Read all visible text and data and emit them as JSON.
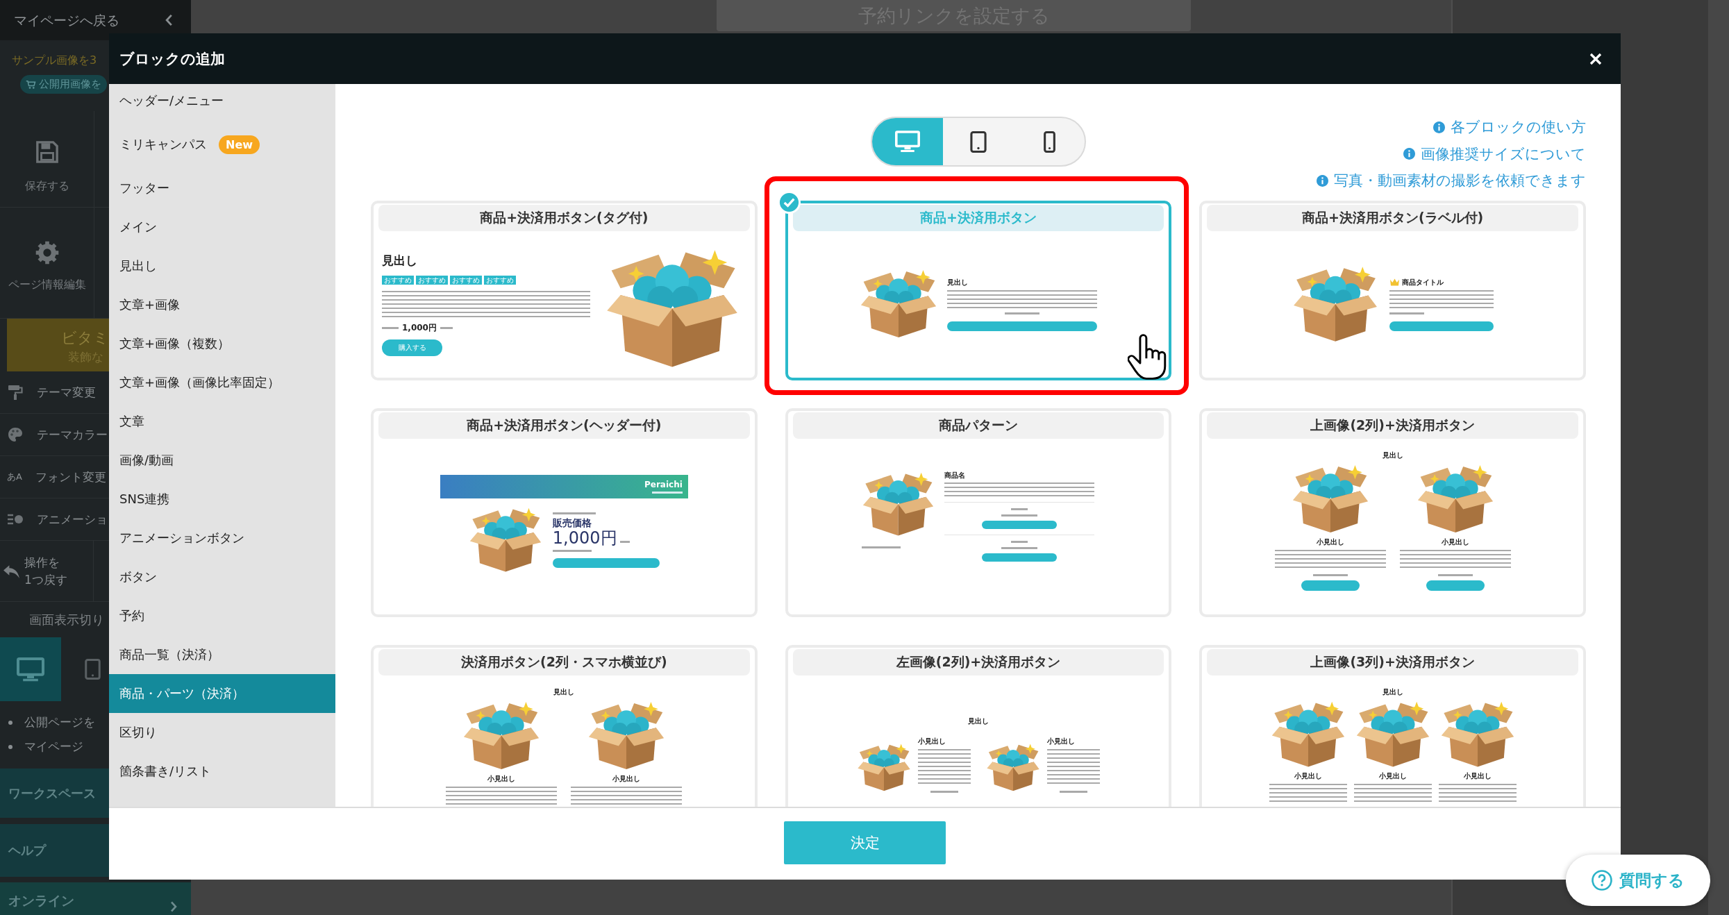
{
  "background": {
    "sidebar": {
      "back_link": "マイページへ戻る",
      "notice": "サンプル画像を3",
      "notice_button": "公開用画像を",
      "actions": [
        {
          "kind": "save",
          "label": "保存する"
        },
        {
          "kind": "settings",
          "label": "ページ情報編集"
        }
      ],
      "banner": {
        "title": "ビタミ",
        "subtitle": "装飾な"
      },
      "menu": [
        {
          "kind": "roller",
          "label": "テーマ変更"
        },
        {
          "kind": "palette",
          "label": "テーマカラー"
        },
        {
          "kind": "font",
          "glyph": "あA",
          "label": "フォント変更"
        },
        {
          "kind": "animation",
          "label": "アニメーショ"
        }
      ],
      "undo": "操作を\n1つ戻す",
      "view_switch": {
        "label": "画面表示切り",
        "devices": [
          {
            "kind": "desktop",
            "selected": true
          },
          {
            "kind": "tablet",
            "selected": false
          }
        ]
      },
      "links": [
        "公開ページを",
        "マイページ"
      ],
      "sections": [
        "ワークスペース",
        "ヘルプ"
      ],
      "footer_section": "オンライン"
    },
    "top_button": "予約リンクを設定する"
  },
  "modal": {
    "title": "ブロックの追加",
    "categories": [
      {
        "label": "ヘッダー/メニュー",
        "selected": false
      },
      {
        "label": "ミリキャンパス",
        "badge": "New",
        "selected": false
      },
      {
        "label": "フッター",
        "selected": false
      },
      {
        "label": "メイン",
        "selected": false
      },
      {
        "label": "見出し",
        "selected": false
      },
      {
        "label": "文章+画像",
        "selected": false
      },
      {
        "label": "文章+画像（複数）",
        "selected": false
      },
      {
        "label": "文章+画像（画像比率固定）",
        "selected": false
      },
      {
        "label": "文章",
        "selected": false
      },
      {
        "label": "画像/動画",
        "selected": false
      },
      {
        "label": "SNS連携",
        "selected": false
      },
      {
        "label": "アニメーションボタン",
        "selected": false
      },
      {
        "label": "ボタン",
        "selected": false
      },
      {
        "label": "予約",
        "selected": false
      },
      {
        "label": "商品一覧（決済）",
        "selected": false
      },
      {
        "label": "商品・パーツ（決済）",
        "selected": true
      },
      {
        "label": "区切り",
        "selected": false
      },
      {
        "label": "箇条書き/リスト",
        "selected": false
      }
    ],
    "devices": [
      {
        "kind": "desktop",
        "selected": true
      },
      {
        "kind": "tablet",
        "selected": false
      },
      {
        "kind": "phone",
        "selected": false
      }
    ],
    "help_links": [
      "各ブロックの使い方",
      "画像推奨サイズについて",
      "写真・動画素材の撮影を依頼できます"
    ],
    "blocks": [
      {
        "title": "商品+決済用ボタン(タグ付)",
        "selected": false,
        "highlighted": false,
        "cursor": false,
        "preview": {
          "kind": "side",
          "heading": "見出し",
          "tags": [
            "おすすめ",
            "おすすめ",
            "おすすめ",
            "おすすめ"
          ],
          "price": "1,000円",
          "button": "購入する"
        }
      },
      {
        "title": "商品+決済用ボタン",
        "selected": true,
        "highlighted": true,
        "cursor": true,
        "preview": {
          "kind": "media",
          "heading": "見出し"
        }
      },
      {
        "title": "商品+決済用ボタン(ラベル付)",
        "selected": false,
        "highlighted": false,
        "cursor": false,
        "preview": {
          "kind": "label-media",
          "heading": "商品タイトル"
        }
      },
      {
        "title": "商品+決済用ボタン(ヘッダー付)",
        "selected": false,
        "highlighted": false,
        "cursor": false,
        "preview": {
          "kind": "header",
          "banner": "Peraichi",
          "label": "販売価格",
          "price": "1,000円"
        }
      },
      {
        "title": "商品パターン",
        "selected": false,
        "highlighted": false,
        "cursor": false,
        "preview": {
          "kind": "pattern",
          "heading": "商品名"
        }
      },
      {
        "title": "上画像(2列)+決済用ボタン",
        "selected": false,
        "highlighted": false,
        "cursor": false,
        "preview": {
          "kind": "columns",
          "heading": "見出し",
          "columns": [
            "小見出し",
            "小見出し"
          ]
        }
      },
      {
        "title": "決済用ボタン(2列・スマホ横並び)",
        "selected": false,
        "highlighted": false,
        "cursor": false,
        "preview": {
          "kind": "columns",
          "heading": "見出し",
          "columns": [
            "小見出し",
            "小見出し"
          ]
        }
      },
      {
        "title": "左画像(2列)+決済用ボタン",
        "selected": false,
        "highlighted": false,
        "cursor": false,
        "preview": {
          "kind": "side-columns",
          "heading": "見出し",
          "columns": [
            "小見出し",
            "小見出し"
          ]
        }
      },
      {
        "title": "上画像(3列)+決済用ボタン",
        "selected": false,
        "highlighted": false,
        "cursor": false,
        "preview": {
          "kind": "columns",
          "heading": "見出し",
          "columns": [
            "小見出し",
            "小見出し",
            "小見出し"
          ]
        }
      }
    ],
    "confirm_button": "決定"
  },
  "help_button": "質問する"
}
